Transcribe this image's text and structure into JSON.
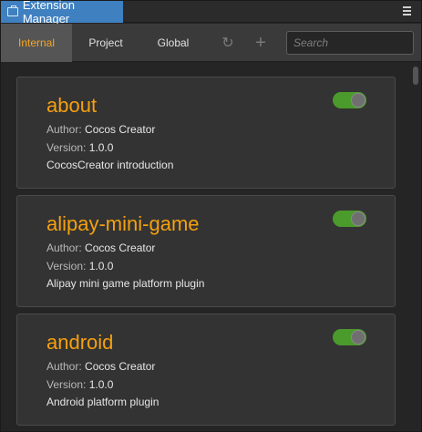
{
  "window": {
    "title": "Extension Manager"
  },
  "toolbar": {
    "tabs": [
      {
        "label": "Internal",
        "active": true
      },
      {
        "label": "Project",
        "active": false
      },
      {
        "label": "Global",
        "active": false
      }
    ],
    "refresh_icon": "refresh-icon",
    "add_icon": "plus-icon",
    "search_placeholder": "Search",
    "search_value": ""
  },
  "colors": {
    "title_tab": "#3f80c0",
    "active_tab_text": "#f5a623",
    "extension_name": "#f5a00e",
    "toggle_on": "#4b9a2c"
  },
  "extensions": [
    {
      "name": "about",
      "author_label": "Author:",
      "author": "Cocos Creator",
      "version_label": "Version:",
      "version": "1.0.0",
      "description": "CocosCreator introduction",
      "enabled": true
    },
    {
      "name": "alipay-mini-game",
      "author_label": "Author:",
      "author": "Cocos Creator",
      "version_label": "Version:",
      "version": "1.0.0",
      "description": "Alipay mini game platform plugin",
      "enabled": true
    },
    {
      "name": "android",
      "author_label": "Author:",
      "author": "Cocos Creator",
      "version_label": "Version:",
      "version": "1.0.0",
      "description": "Android platform plugin",
      "enabled": true
    }
  ]
}
